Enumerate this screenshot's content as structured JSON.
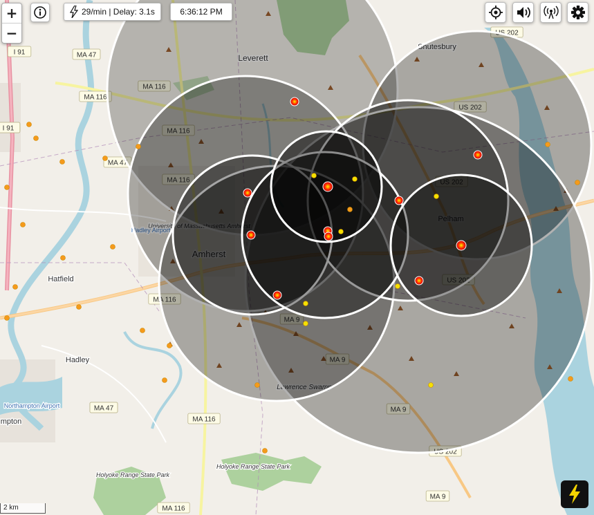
{
  "stats": {
    "rate": "29/min | Delay: 3.1s",
    "time": "6:36:12 PM"
  },
  "controls": {
    "zoom_in": "+",
    "zoom_out": "−",
    "info_icon": "info-icon",
    "locate_icon": "crosshair-icon",
    "sound_icon": "speaker-icon",
    "signal_icon": "broadcast-icon",
    "settings_icon": "gear-icon",
    "lightning_icon": "lightning-icon"
  },
  "scale": {
    "label": "2 km"
  },
  "places": [
    "Leverett",
    "Shutesbury",
    "Pelham",
    "Amherst",
    "Hatfield",
    "Hadley",
    "University of Massachusetts Amherst",
    "Hadley Airport",
    "Northampton Airport",
    "Lawrence Swamp",
    "Holyoke Range State Park",
    "Holyoke Range State Park",
    "mpton"
  ],
  "roads": [
    "MA 47",
    "MA 116",
    "MA 47",
    "MA 116",
    "MA 47",
    "MA 116",
    "MA 116",
    "MA 116",
    "MA 9",
    "MA 9",
    "MA 9",
    "MA 9",
    "MA 47",
    "MA 116",
    "MA 116",
    "US 202",
    "US 202",
    "US 202",
    "US 202",
    "US 202",
    "I 91",
    "I 91",
    "I 91"
  ],
  "colors": {
    "land": "#f2efe9",
    "water": "#aad3df",
    "forest": "#add19e",
    "circle_fill": "#000000",
    "circle_stroke": "#ffffff",
    "strike_recent": "#e8142a",
    "strike_old": "#f5e000",
    "strike_mid": "#f59a1c",
    "accent": "#f5d400"
  }
}
